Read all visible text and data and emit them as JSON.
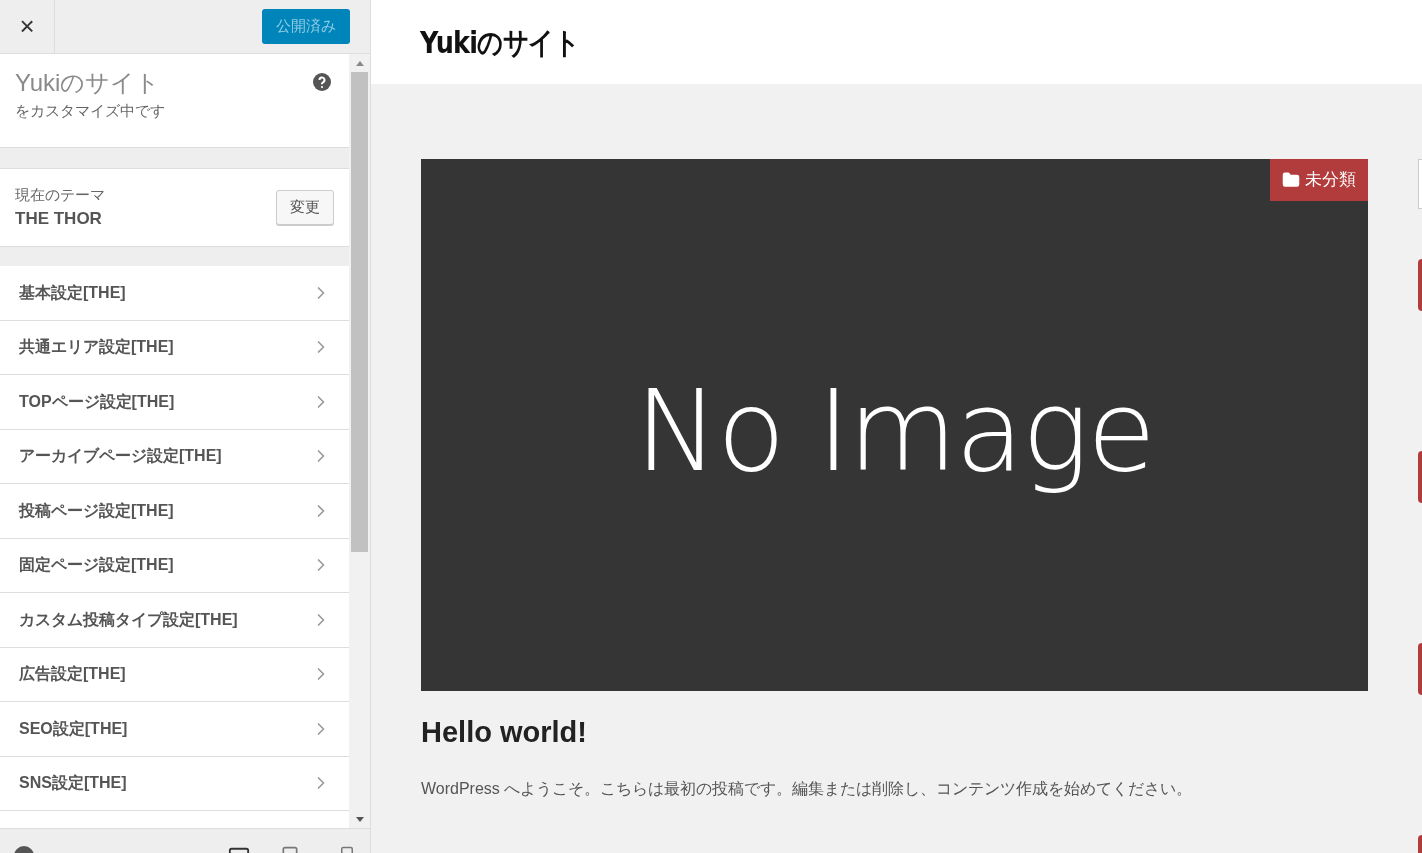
{
  "sidebar": {
    "close_label": "×",
    "publish_button": "公開済み",
    "site_title": "Yukiのサイト",
    "site_subtitle": "をカスタマイズ中です",
    "theme": {
      "label": "現在のテーマ",
      "name": "THE THOR",
      "change_button": "変更"
    },
    "sections": [
      {
        "label": "基本設定[THE]"
      },
      {
        "label": "共通エリア設定[THE]"
      },
      {
        "label": "TOPページ設定[THE]"
      },
      {
        "label": "アーカイブページ設定[THE]"
      },
      {
        "label": "投稿ページ設定[THE]"
      },
      {
        "label": "固定ページ設定[THE]"
      },
      {
        "label": "カスタム投稿タイプ設定[THE]"
      },
      {
        "label": "広告設定[THE]"
      },
      {
        "label": "SEO設定[THE]"
      },
      {
        "label": "SNS設定[THE]"
      }
    ]
  },
  "preview": {
    "site_title": "Yukiのサイト",
    "post": {
      "category": "未分類",
      "image_text": "No Image",
      "title": "Hello world!",
      "excerpt": "WordPress へようこそ。こちらは最初の投稿です。編集または削除し、コンテンツ作成を始めてください。"
    }
  }
}
